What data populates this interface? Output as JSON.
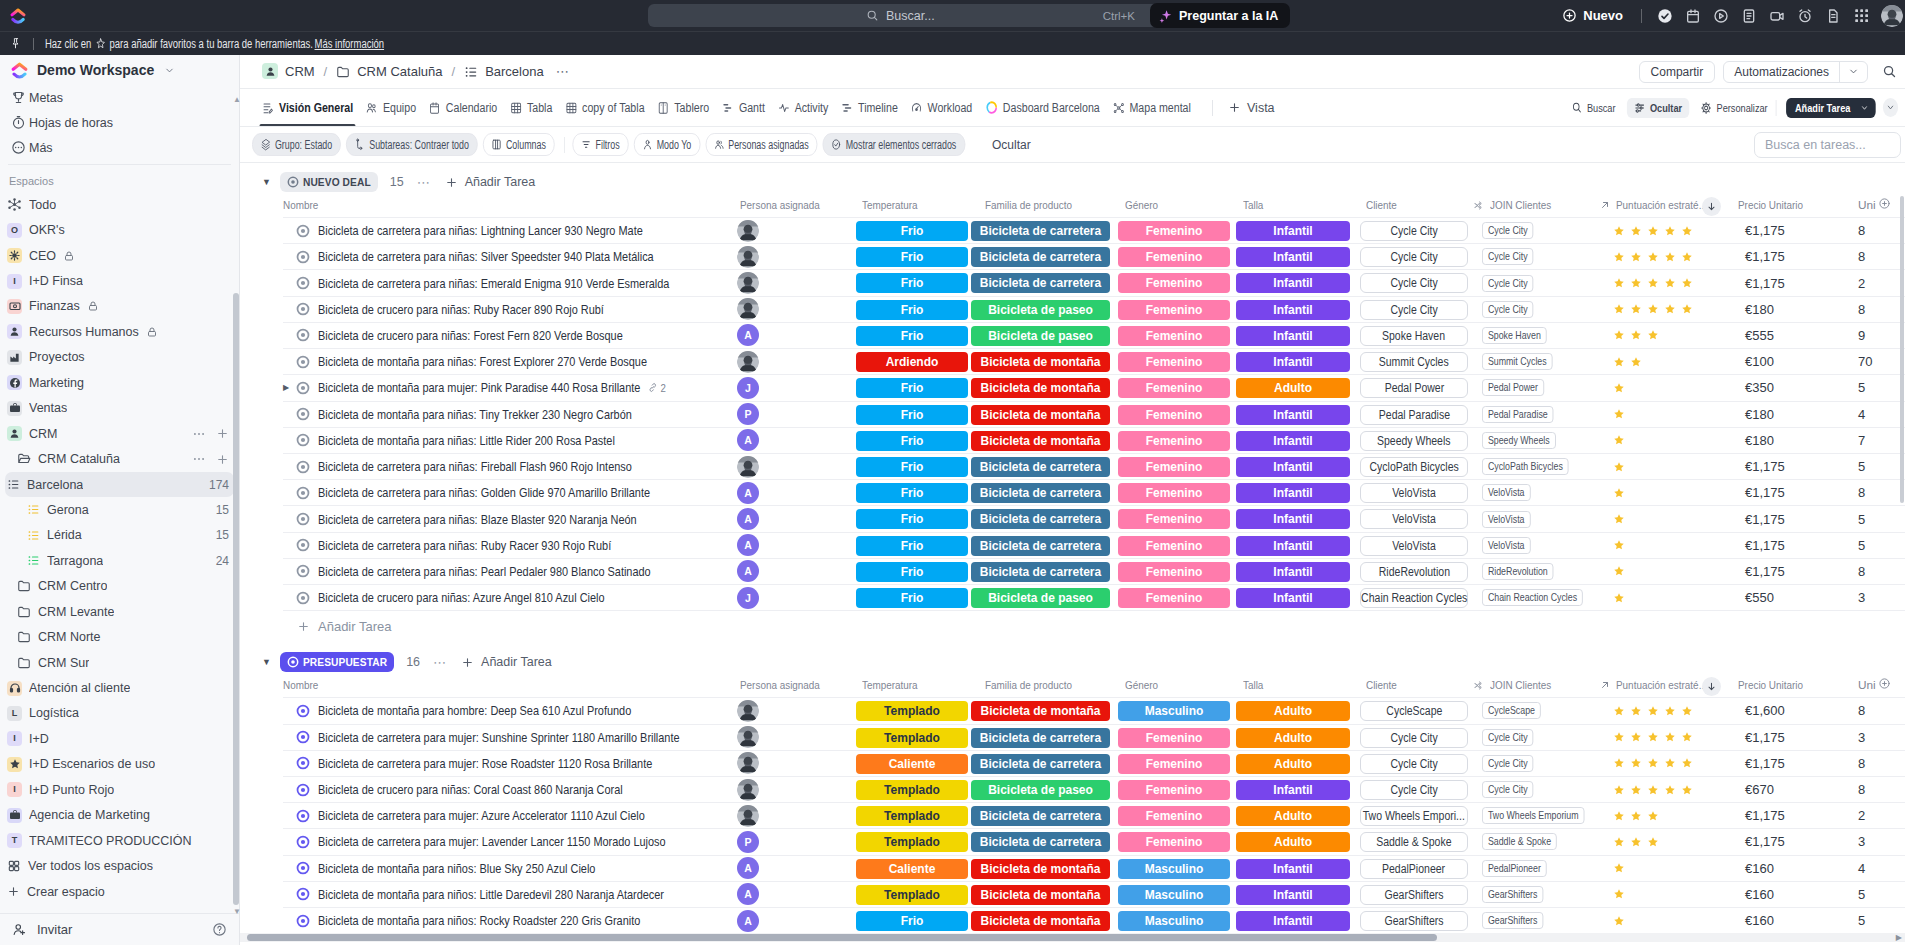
{
  "topbar": {
    "search_placeholder": "Buscar...",
    "shortcut": "Ctrl+K",
    "ask_ai": "Preguntar a la IA",
    "new_label": "Nuevo",
    "icons": [
      "check-circle-icon",
      "calendar-icon",
      "play-circle-icon",
      "notepad-icon",
      "video-icon",
      "alarm-icon",
      "doc-icon",
      "apps-grid-icon"
    ]
  },
  "favbar": {
    "pre": "Haz clic en",
    "post": "para añadir favoritos a tu barra de herramientas.",
    "link": "Más información"
  },
  "sidebar": {
    "workspace": "Demo Workspace",
    "top_items": [
      {
        "icon": "trophy",
        "label": "Metas"
      },
      {
        "icon": "timer",
        "label": "Hojas de horas"
      },
      {
        "icon": "more-circle",
        "label": "Más"
      }
    ],
    "section": "Espacios",
    "items": [
      {
        "icon": "todo",
        "label": "Todo",
        "indent": 0
      },
      {
        "icon": "letter",
        "letter": "O",
        "bg": "#dfdbf9",
        "label": "OKR's",
        "indent": 0
      },
      {
        "icon": "sun",
        "bg": "#f8e3ac",
        "label": "CEO",
        "lock": true,
        "indent": 0
      },
      {
        "icon": "letter",
        "letter": "I",
        "bg": "#dfdbf9",
        "label": "I+D Finsa",
        "indent": 0
      },
      {
        "icon": "cash",
        "bg": "#f9d4d2",
        "label": "Finanzas",
        "lock": true,
        "indent": 0
      },
      {
        "icon": "person",
        "bg": "#dfdbf9",
        "label": "Recursos Humanos",
        "lock": true,
        "indent": 0
      },
      {
        "icon": "factory",
        "bg": "#e2e4e8",
        "label": "Proyectos",
        "indent": 0
      },
      {
        "icon": "fb",
        "bg": "#d9d8f8",
        "label": "Marketing",
        "indent": 0
      },
      {
        "icon": "briefcase",
        "bg": "#e2e4e8",
        "label": "Ventas",
        "indent": 0
      },
      {
        "icon": "person",
        "bg": "#cdeedd",
        "label": "CRM",
        "indent": 0,
        "actions": true
      },
      {
        "icon": "folder-open",
        "label": "CRM Cataluña",
        "indent": 1,
        "actions": true
      },
      {
        "icon": "list",
        "color": "#454b57",
        "label": "Barcelona",
        "indent": 2,
        "count": "174",
        "active": true
      },
      {
        "icon": "list",
        "color": "#f0c030",
        "label": "Gerona",
        "indent": 2,
        "count": "15"
      },
      {
        "icon": "list",
        "color": "#f0c030",
        "label": "Lérida",
        "indent": 2,
        "count": "15"
      },
      {
        "icon": "list",
        "color": "#2bce6e",
        "label": "Tarragona",
        "indent": 2,
        "count": "24"
      },
      {
        "icon": "folder",
        "label": "CRM Centro",
        "indent": 1
      },
      {
        "icon": "folder",
        "label": "CRM Levante",
        "indent": 1
      },
      {
        "icon": "folder",
        "label": "CRM Norte",
        "indent": 1
      },
      {
        "icon": "folder",
        "label": "CRM Sur",
        "indent": 1
      },
      {
        "icon": "headset",
        "bg": "#f6dfc4",
        "label": "Atención al cliente",
        "indent": 0
      },
      {
        "icon": "letter",
        "letter": "L",
        "bg": "#e2e4e8",
        "label": "Logística",
        "indent": 0
      },
      {
        "icon": "letter",
        "letter": "I",
        "bg": "#dfdbf9",
        "label": "I+D",
        "indent": 0
      },
      {
        "icon": "star",
        "bg": "#f8e3ac",
        "label": "I+D Escenarios de uso",
        "indent": 0
      },
      {
        "icon": "letter",
        "letter": "I",
        "bg": "#f9d4d2",
        "label": "I+D Punto Rojo",
        "indent": 0
      },
      {
        "icon": "briefcase",
        "bg": "#d9d8f8",
        "label": "Agencia de Marketing",
        "indent": 0
      },
      {
        "icon": "letter",
        "letter": "T",
        "bg": "#dfdbf9",
        "label": "TRAMITECO PRODUCCIÓN",
        "indent": 0
      },
      {
        "icon": "grid",
        "label": "Ver todos los espacios",
        "indent": 0
      },
      {
        "icon": "plus",
        "label": "Crear espacio",
        "indent": 0
      }
    ],
    "invite": "Invitar"
  },
  "breadcrumb": [
    {
      "icon": "crm-box",
      "label": "CRM"
    },
    {
      "icon": "folder",
      "label": "CRM Cataluña"
    },
    {
      "icon": "list-lines",
      "label": "Barcelona"
    }
  ],
  "actions": {
    "share": "Compartir",
    "automations": "Automatizaciones"
  },
  "tabs": [
    {
      "icon": "overview",
      "label": "Visión General",
      "active": true
    },
    {
      "icon": "people2",
      "label": "Equipo"
    },
    {
      "icon": "calendar",
      "label": "Calendario"
    },
    {
      "icon": "table",
      "label": "Tabla"
    },
    {
      "icon": "table",
      "label": "copy of Tabla"
    },
    {
      "icon": "board",
      "label": "Tablero"
    },
    {
      "icon": "gantt",
      "label": "Gantt"
    },
    {
      "icon": "pulse",
      "label": "Activity"
    },
    {
      "icon": "timeline",
      "label": "Timeline"
    },
    {
      "icon": "gauge",
      "label": "Workload"
    },
    {
      "icon": "dash-color",
      "label": "Dasboard Barcelona"
    },
    {
      "icon": "mindmap",
      "label": "Mapa mental"
    }
  ],
  "view_controls": {
    "add_view": "Vista",
    "search": "Buscar",
    "hide": "Ocultar",
    "customize": "Personalizar",
    "add_task": "Añadir Tarea"
  },
  "toolbar": {
    "pills": [
      {
        "icon": "layers",
        "label": "Grupo: Estado",
        "filled": true
      },
      {
        "icon": "subtask",
        "label": "Subtareas: Contraer todo",
        "filled": true
      },
      {
        "icon": "columns",
        "label": "Columnas"
      },
      {
        "divider": true
      },
      {
        "icon": "filter",
        "label": "Filtros"
      },
      {
        "icon": "person-o",
        "label": "Modo Yo"
      },
      {
        "icon": "people-o",
        "label": "Personas asignadas"
      },
      {
        "icon": "check-circle-o",
        "label": "Mostrar elementos cerrados",
        "filled": true
      }
    ],
    "hide": "Ocultar",
    "task_search_placeholder": "Busca en tareas..."
  },
  "table": {
    "columns": {
      "nombre": "Nombre",
      "persona": "Persona asignada",
      "temperatura": "Temperatura",
      "familia": "Familia de producto",
      "genero": "Género",
      "talla": "Talla",
      "cliente": "Cliente",
      "join": "JOIN Clientes",
      "puntuacion": "Puntuación estraté...",
      "precio": "Precio Unitario",
      "unidades": "Uni"
    },
    "add_task_label": "Añadir Tarea",
    "groups": [
      {
        "status": "NUEVO DEAL",
        "count": "15",
        "pill_bg": "#e9ebef",
        "pill_fg": "#3f4754",
        "donut": "#737d8c",
        "row_donut": "#8f97a4",
        "show_footer_add": true,
        "rows": [
          {
            "name": "Bicicleta de carretera para niñas: Lightning Lancer 930 Negro Mate",
            "avatar": "photo",
            "temperatura": "Frio",
            "familia": "Bicicleta de carretera",
            "genero": "Femenino",
            "talla": "Infantil",
            "cliente": "Cycle City",
            "join_cliente": "Cycle City",
            "stars": 5,
            "precio": "€1,175",
            "unidades": "8"
          },
          {
            "name": "Bicicleta de carretera para niñas: Silver Speedster 940 Plata Metálica",
            "avatar": "photo",
            "temperatura": "Frio",
            "familia": "Bicicleta de carretera",
            "genero": "Femenino",
            "talla": "Infantil",
            "cliente": "Cycle City",
            "join_cliente": "Cycle City",
            "stars": 5,
            "precio": "€1,175",
            "unidades": "8"
          },
          {
            "name": "Bicicleta de carretera para niñas: Emerald Enigma 910 Verde Esmeralda",
            "avatar": "photo",
            "temperatura": "Frio",
            "familia": "Bicicleta de carretera",
            "genero": "Femenino",
            "talla": "Infantil",
            "cliente": "Cycle City",
            "join_cliente": "Cycle City",
            "stars": 5,
            "precio": "€1,175",
            "unidades": "2"
          },
          {
            "name": "Bicicleta de crucero para niñas: Ruby Racer 890 Rojo Rubí",
            "avatar": "photo",
            "temperatura": "Frio",
            "familia": "Bicicleta de paseo",
            "genero": "Femenino",
            "talla": "Infantil",
            "cliente": "Cycle City",
            "join_cliente": "Cycle City",
            "stars": 5,
            "precio": "€180",
            "unidades": "8"
          },
          {
            "name": "Bicicleta de crucero para niñas: Forest Fern 820 Verde Bosque",
            "avatar": "A",
            "temperatura": "Frio",
            "familia": "Bicicleta de paseo",
            "genero": "Femenino",
            "talla": "Infantil",
            "cliente": "Spoke Haven",
            "join_cliente": "Spoke Haven",
            "stars": 3,
            "precio": "€555",
            "unidades": "9"
          },
          {
            "name": "Bicicleta de montaña para niñas: Forest Explorer 270 Verde Bosque",
            "avatar": "photo",
            "temperatura": "Ardiendo",
            "familia": "Bicicleta de montaña",
            "genero": "Femenino",
            "talla": "Infantil",
            "cliente": "Summit Cycles",
            "join_cliente": "Summit Cycles",
            "stars": 2,
            "precio": "€100",
            "unidades": "70"
          },
          {
            "name": "Bicicleta de montaña para mujer: Pink Paradise 440 Rosa Brillante",
            "avatar": "J",
            "temperatura": "Frio",
            "familia": "Bicicleta de montaña",
            "genero": "Femenino",
            "talla": "Adulto",
            "cliente": "Pedal Power",
            "join_cliente": "Pedal Power",
            "stars": 1,
            "precio": "€350",
            "unidades": "5",
            "expand": true,
            "subtasks": "2"
          },
          {
            "name": "Bicicleta de montaña para niñas: Tiny Trekker 230 Negro Carbón",
            "avatar": "P",
            "temperatura": "Frio",
            "familia": "Bicicleta de montaña",
            "genero": "Femenino",
            "talla": "Infantil",
            "cliente": "Pedal Paradise",
            "join_cliente": "Pedal Paradise",
            "stars": 1,
            "precio": "€180",
            "unidades": "4"
          },
          {
            "name": "Bicicleta de montaña para niñas: Little Rider 200 Rosa Pastel",
            "avatar": "A",
            "temperatura": "Frio",
            "familia": "Bicicleta de montaña",
            "genero": "Femenino",
            "talla": "Infantil",
            "cliente": "Speedy Wheels",
            "join_cliente": "Speedy Wheels",
            "stars": 1,
            "precio": "€180",
            "unidades": "7"
          },
          {
            "name": "Bicicleta de carretera para niñas: Fireball Flash 960 Rojo Intenso",
            "avatar": "photo",
            "temperatura": "Frio",
            "familia": "Bicicleta de carretera",
            "genero": "Femenino",
            "talla": "Infantil",
            "cliente": "CycloPath Bicycles",
            "join_cliente": "CycloPath Bicycles",
            "stars": 1,
            "precio": "€1,175",
            "unidades": "5"
          },
          {
            "name": "Bicicleta de carretera para niñas: Golden Glide 970 Amarillo Brillante",
            "avatar": "A",
            "temperatura": "Frio",
            "familia": "Bicicleta de carretera",
            "genero": "Femenino",
            "talla": "Infantil",
            "cliente": "VeloVista",
            "join_cliente": "VeloVista",
            "stars": 1,
            "precio": "€1,175",
            "unidades": "8"
          },
          {
            "name": "Bicicleta de carretera para niñas: Blaze Blaster 920 Naranja Neón",
            "avatar": "A",
            "temperatura": "Frio",
            "familia": "Bicicleta de carretera",
            "genero": "Femenino",
            "talla": "Infantil",
            "cliente": "VeloVista",
            "join_cliente": "VeloVista",
            "stars": 1,
            "precio": "€1,175",
            "unidades": "5"
          },
          {
            "name": "Bicicleta de carretera para niñas: Ruby Racer 930 Rojo Rubí",
            "avatar": "A",
            "temperatura": "Frio",
            "familia": "Bicicleta de carretera",
            "genero": "Femenino",
            "talla": "Infantil",
            "cliente": "VeloVista",
            "join_cliente": "VeloVista",
            "stars": 1,
            "precio": "€1,175",
            "unidades": "5"
          },
          {
            "name": "Bicicleta de carretera para niñas: Pearl Pedaler 980 Blanco Satinado",
            "avatar": "A",
            "temperatura": "Frio",
            "familia": "Bicicleta de carretera",
            "genero": "Femenino",
            "talla": "Infantil",
            "cliente": "RideRevolution",
            "join_cliente": "RideRevolution",
            "stars": 1,
            "precio": "€1,175",
            "unidades": "8"
          },
          {
            "name": "Bicicleta de crucero para niñas: Azure Angel 810 Azul Cielo",
            "avatar": "J",
            "temperatura": "Frio",
            "familia": "Bicicleta de paseo",
            "genero": "Femenino",
            "talla": "Infantil",
            "cliente": "Chain Reaction Cycles",
            "join_cliente": "Chain Reaction Cycles",
            "stars": 1,
            "precio": "€550",
            "unidades": "3"
          }
        ]
      },
      {
        "status": "PRESUPUESTAR",
        "count": "16",
        "pill_bg": "#5b4fee",
        "pill_fg": "#ffffff",
        "donut": "#ffffff",
        "row_donut": "#6459f0",
        "show_footer_add": false,
        "rows": [
          {
            "name": "Bicicleta de montaña para hombre: Deep Sea 610 Azul Profundo",
            "avatar": "photo",
            "temperatura": "Templado",
            "familia": "Bicicleta de montaña",
            "genero": "Masculino",
            "talla": "Adulto",
            "cliente": "CycleScape",
            "join_cliente": "CycleScape",
            "stars": 5,
            "precio": "€1,600",
            "unidades": "8"
          },
          {
            "name": "Bicicleta de carretera para mujer: Sunshine Sprinter 1180 Amarillo Brillante",
            "avatar": "photo",
            "temperatura": "Templado",
            "familia": "Bicicleta de carretera",
            "genero": "Femenino",
            "talla": "Adulto",
            "cliente": "Cycle City",
            "join_cliente": "Cycle City",
            "stars": 5,
            "precio": "€1,175",
            "unidades": "3"
          },
          {
            "name": "Bicicleta de carretera para mujer: Rose Roadster 1120 Rosa Brillante",
            "avatar": "photo",
            "temperatura": "Caliente",
            "familia": "Bicicleta de carretera",
            "genero": "Femenino",
            "talla": "Adulto",
            "cliente": "Cycle City",
            "join_cliente": "Cycle City",
            "stars": 5,
            "precio": "€1,175",
            "unidades": "8"
          },
          {
            "name": "Bicicleta de crucero para niñas: Coral Coast 860 Naranja Coral",
            "avatar": "photo",
            "temperatura": "Templado",
            "familia": "Bicicleta de paseo",
            "genero": "Femenino",
            "talla": "Infantil",
            "cliente": "Cycle City",
            "join_cliente": "Cycle City",
            "stars": 5,
            "precio": "€670",
            "unidades": "8"
          },
          {
            "name": "Bicicleta de carretera para mujer: Azure Accelerator 1110 Azul Cielo",
            "avatar": "photo",
            "temperatura": "Templado",
            "familia": "Bicicleta de carretera",
            "genero": "Femenino",
            "talla": "Adulto",
            "cliente": "Two Wheels Empori...",
            "join_cliente": "Two Wheels Emporium",
            "stars": 3,
            "precio": "€1,175",
            "unidades": "2"
          },
          {
            "name": "Bicicleta de carretera para mujer: Lavender Lancer 1150 Morado Lujoso",
            "avatar": "P",
            "temperatura": "Templado",
            "familia": "Bicicleta de carretera",
            "genero": "Femenino",
            "talla": "Adulto",
            "cliente": "Saddle & Spoke",
            "join_cliente": "Saddle & Spoke",
            "stars": 3,
            "precio": "€1,175",
            "unidades": "3"
          },
          {
            "name": "Bicicleta de montaña para niños: Blue Sky 250 Azul Cielo",
            "avatar": "A",
            "temperatura": "Caliente",
            "familia": "Bicicleta de montaña",
            "genero": "Masculino",
            "talla": "Infantil",
            "cliente": "PedalPioneer",
            "join_cliente": "PedalPioneer",
            "stars": 1,
            "precio": "€160",
            "unidades": "4"
          },
          {
            "name": "Bicicleta de montaña para niños: Little Daredevil 280 Naranja Atardecer",
            "avatar": "A",
            "temperatura": "Templado",
            "familia": "Bicicleta de montaña",
            "genero": "Masculino",
            "talla": "Infantil",
            "cliente": "GearShifters",
            "join_cliente": "GearShifters",
            "stars": 1,
            "precio": "€160",
            "unidades": "5"
          },
          {
            "name": "Bicicleta de montaña para niños: Rocky Roadster 220 Gris Granito",
            "avatar": "A",
            "temperatura": "Frio",
            "familia": "Bicicleta de montaña",
            "genero": "Masculino",
            "talla": "Infantil",
            "cliente": "GearShifters",
            "join_cliente": "GearShifters",
            "stars": 1,
            "precio": "€160",
            "unidades": "5"
          }
        ]
      }
    ]
  },
  "palette": {
    "temperatura": {
      "Frio": "#00a8f4",
      "Templado": "#f2d600",
      "Caliente": "#fe7a1b",
      "Ardiendo": "#e8150b"
    },
    "temperatura_text": {
      "Templado": "#2a3345"
    },
    "familia": {
      "Bicicleta de carretera": "#38759e",
      "Bicicleta de paseo": "#2bce6e",
      "Bicicleta de montaña": "#e8150b"
    },
    "genero": {
      "Femenino": "#ff7bac",
      "Masculino": "#41a0e8"
    },
    "talla": {
      "Infantil": "#7845ec",
      "Adulto": "#fc8a00"
    },
    "stars": "#f7c22d",
    "avatar_letter_bg": "#7d6ce9"
  }
}
